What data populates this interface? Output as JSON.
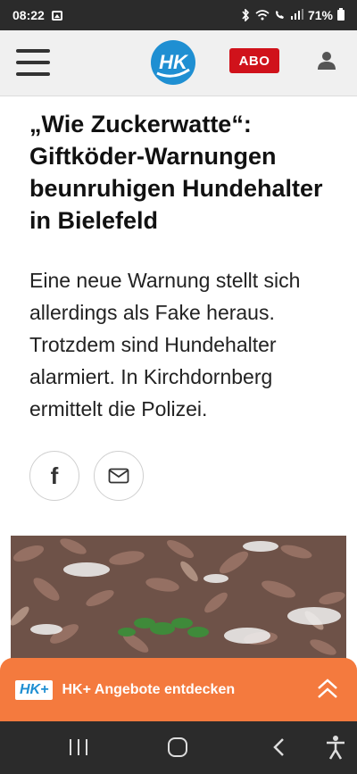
{
  "status_bar": {
    "time": "08:22",
    "battery": "71%",
    "icons": [
      "image-icon",
      "bluetooth-icon",
      "wifi-icon",
      "wifi-call-icon",
      "signal-icon",
      "battery-icon"
    ]
  },
  "header": {
    "logo_text": "HK",
    "abo_label": "ABO",
    "icons": [
      "menu-icon",
      "user-icon"
    ],
    "brand_color": "#1f8fd2",
    "abo_color": "#d0121b"
  },
  "article": {
    "headline": "„Wie Zuckerwatte“: Giftköder-Warnungen beunruhigen Hundehalter in Bielefeld",
    "lead": "Eine neue Warnung stellt sich allerdings als Fake heraus. Trotzdem sind Hundehalter alarmiert. In Kirchdornberg ermittelt die Polizei.",
    "share": {
      "facebook_glyph": "f",
      "icons": [
        "facebook-icon",
        "mail-icon"
      ]
    }
  },
  "promo": {
    "badge": "HK+",
    "text": "HK+ Angebote entdecken",
    "color": "#f47a3e",
    "icon": "double-chevron-up-icon"
  },
  "nav_bar": {
    "icons": [
      "recent-apps-icon",
      "home-icon",
      "back-icon",
      "accessibility-icon"
    ]
  }
}
